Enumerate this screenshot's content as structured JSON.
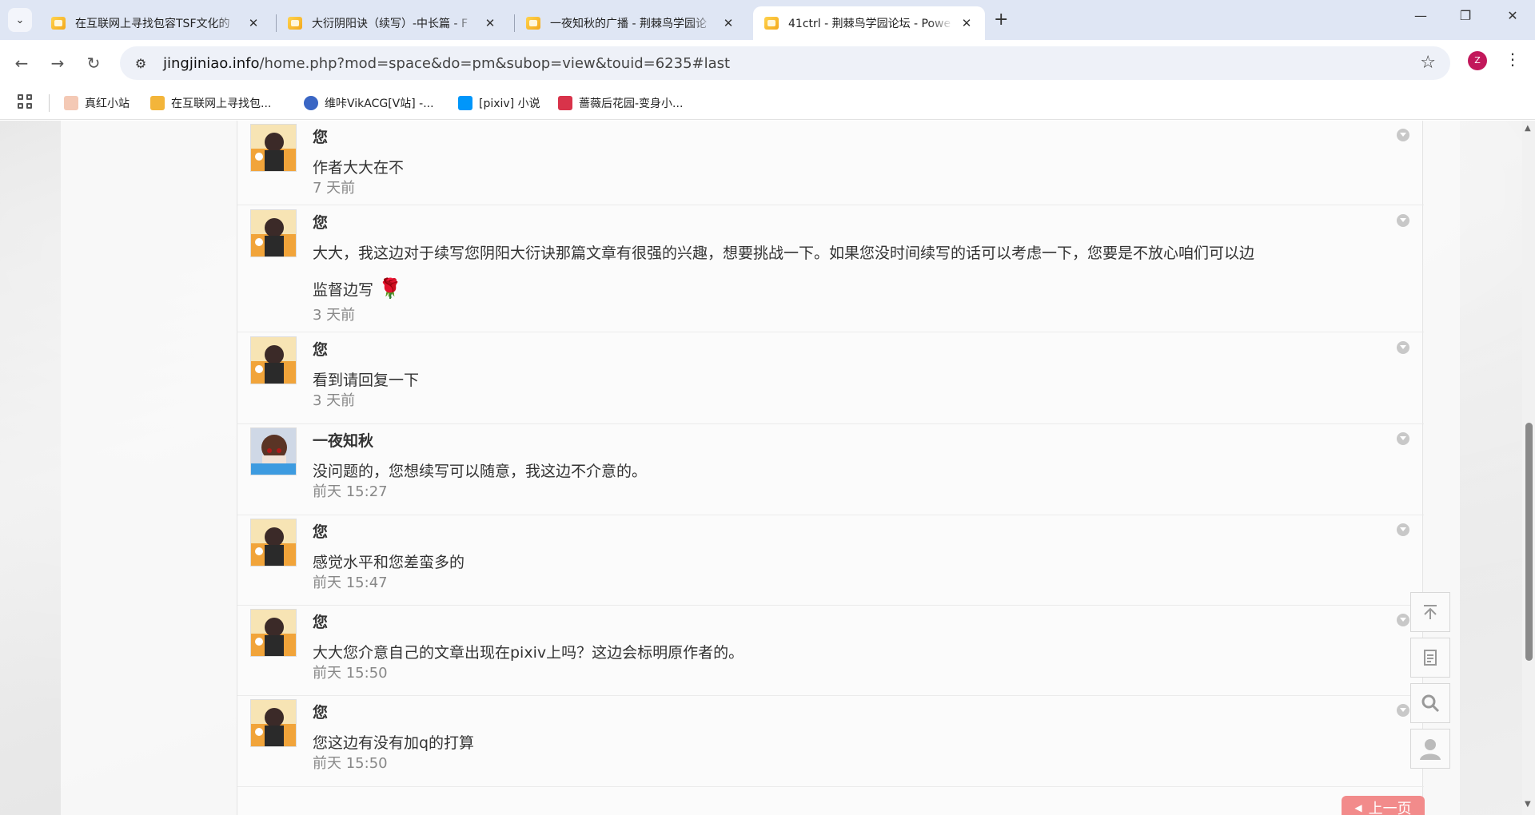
{
  "browser": {
    "tabs": [
      {
        "title": "在互联网上寻找包容TSF文化的",
        "active": false
      },
      {
        "title": "大衍阴阳诀（续写）-中长篇 - F",
        "active": false
      },
      {
        "title": "一夜知秋的广播 - 荆棘鸟学园论",
        "active": false
      },
      {
        "title": "41ctrl - 荆棘鸟学园论坛 - Powe",
        "active": true
      }
    ],
    "new_tab": "+",
    "window_controls": {
      "minimize": "—",
      "restore": "❐",
      "close": "✕"
    },
    "url_host": "jingjiniao.info",
    "url_path": "/home.php?mod=space&do=pm&subop=view&touid=6235#last",
    "profile_initial": "Z"
  },
  "bookmarks": [
    {
      "label": "真红小站",
      "color": "#f4c9b5"
    },
    {
      "label": "在互联网上寻找包...",
      "color": "#f3b53a"
    },
    {
      "label": "维咔VikACG[V站] -...",
      "color": "#3a66c4"
    },
    {
      "label": "[pixiv] 小说",
      "color": "#0096fa"
    },
    {
      "label": "蔷薇后花园-变身小...",
      "color": "#d8334a"
    }
  ],
  "messages": [
    {
      "sender": "您",
      "text": "作者大大在不",
      "time": "7 天前",
      "avatar": "user"
    },
    {
      "sender": "您",
      "text": "大大，我这边对于续写您阴阳大衍诀那篇文章有很强的兴趣，想要挑战一下。如果您没时间续写的话可以考虑一下，您要是不放心咱们可以边",
      "text2": "监督边写",
      "time": "3 天前",
      "avatar": "user"
    },
    {
      "sender": "您",
      "text": "看到请回复一下",
      "time": "3 天前",
      "avatar": "user"
    },
    {
      "sender": "一夜知秋",
      "text": "没问题的，您想续写可以随意，我这边不介意的。",
      "time": "前天 15:27",
      "avatar": "other"
    },
    {
      "sender": "您",
      "text": "感觉水平和您差蛮多的",
      "time": "前天 15:47",
      "avatar": "user"
    },
    {
      "sender": "您",
      "text": "大大您介意自己的文章出现在pixiv上吗？这边会标明原作者的。",
      "time": "前天 15:50",
      "avatar": "user"
    },
    {
      "sender": "您",
      "text": "您这边有没有加q的打算",
      "time": "前天 15:50",
      "avatar": "user"
    }
  ],
  "pagination": {
    "prev_label": "上一页"
  },
  "colors": {
    "accent_prev": "#f28b8b",
    "profile": "#c2185b"
  }
}
